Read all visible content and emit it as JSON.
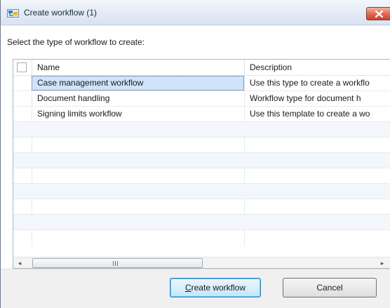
{
  "window": {
    "title": "Create workflow (1)"
  },
  "instruction": "Select the type of workflow to create:",
  "grid": {
    "columns": [
      "Name",
      "Description"
    ],
    "rows": [
      {
        "name": "Case management workflow",
        "description": "Use this type to create a workflo",
        "selected": true
      },
      {
        "name": "Document handling",
        "description": "Workflow type for document h",
        "selected": false
      },
      {
        "name": "Signing limits workflow",
        "description": "Use this template to create a wo",
        "selected": false
      }
    ],
    "scrollbar": {
      "left_arrow": "◂",
      "right_arrow": "▸"
    }
  },
  "buttons": {
    "create": {
      "mnemonic": "C",
      "rest": "reate workflow"
    },
    "cancel": "Cancel"
  },
  "colors": {
    "selection": "#cfe3fb",
    "close_button": "#d9533c",
    "default_button_border": "#3c7fb1"
  },
  "icons": {
    "app": "workflow-app-icon",
    "close": "close-icon"
  }
}
